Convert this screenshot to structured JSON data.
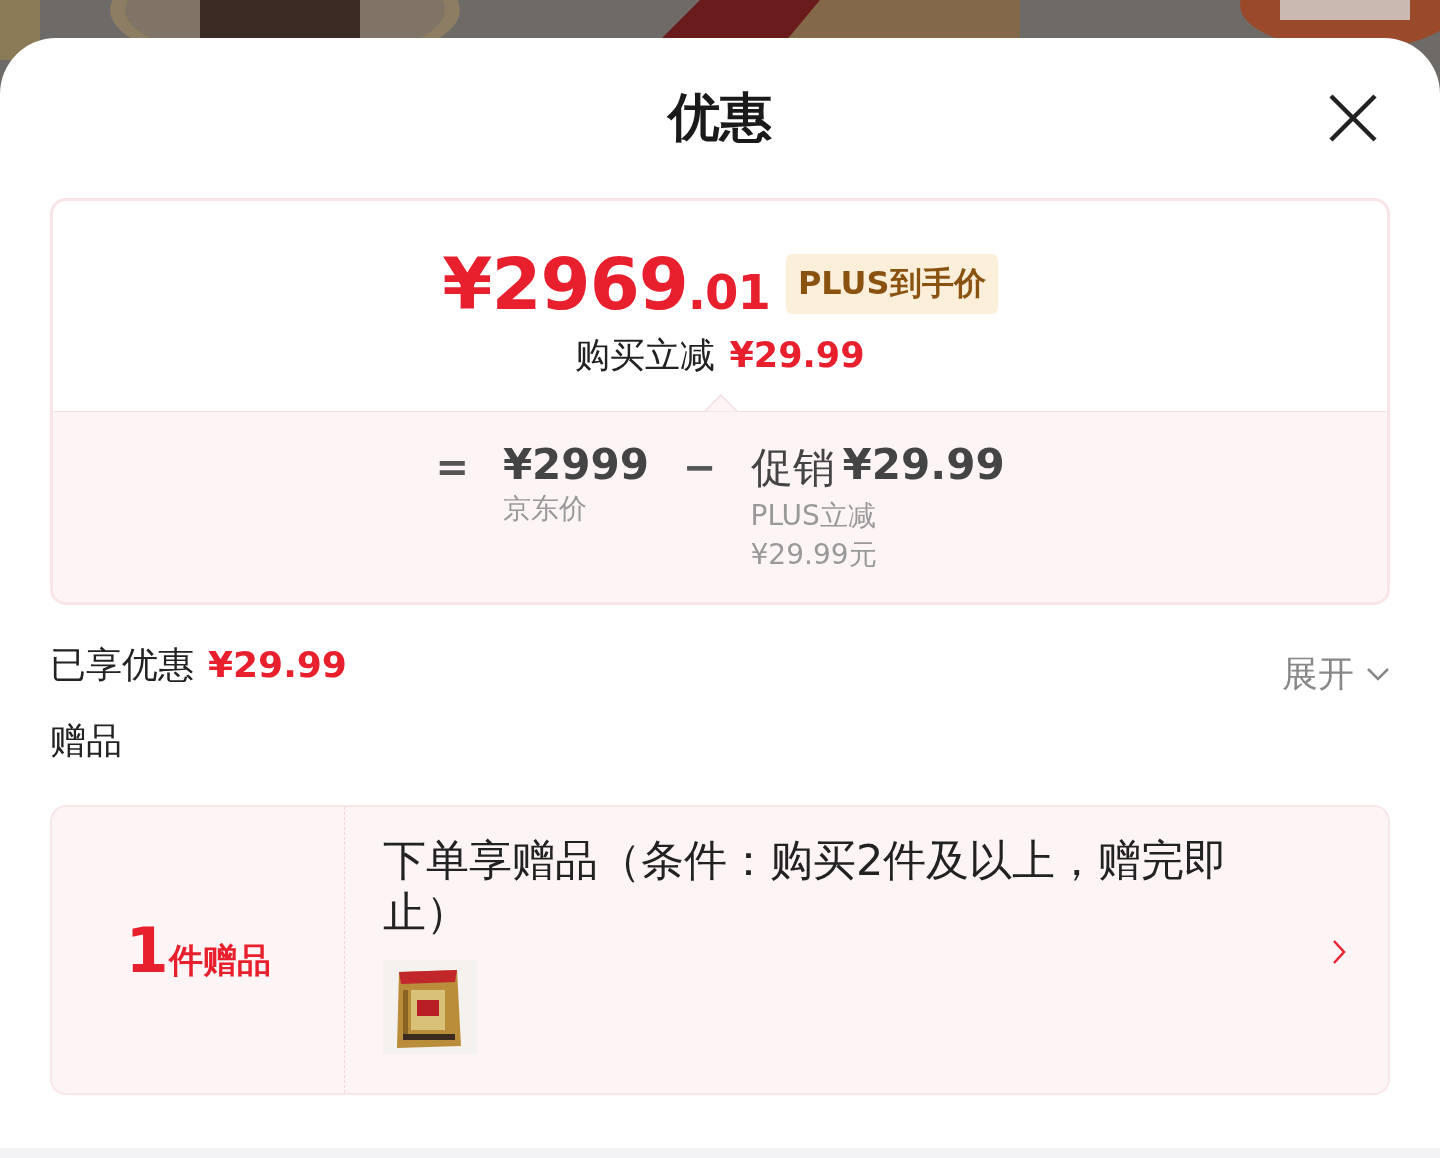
{
  "sheet": {
    "title": "优惠"
  },
  "price_card": {
    "final_price": "¥2969",
    "final_price_decimal": ".01",
    "badge": "PLUS到手价",
    "reduction_label": "购买立减",
    "reduction_amount": "¥29.99",
    "formula": {
      "equals": "=",
      "base_price": "¥2999",
      "base_price_label": "京东价",
      "minus": "−",
      "promo_label": "促销",
      "promo_amount": "¥29.99",
      "promo_detail": "PLUS立减",
      "promo_detail_amount": "¥29.99元"
    }
  },
  "savings": {
    "label": "已享优惠",
    "amount": "¥29.99",
    "toggle": "展开",
    "expanded": false
  },
  "gifts": {
    "heading": "赠品",
    "count": "1",
    "count_label": "件赠品",
    "description": "下单享赠品（条件：购买2件及以上，赠完即止）"
  }
}
